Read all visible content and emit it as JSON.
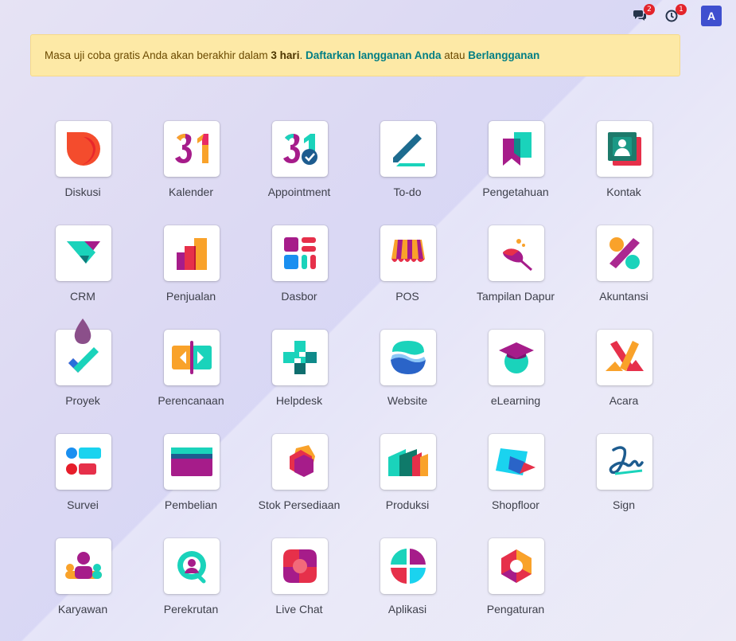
{
  "topbar": {
    "messages_badge": "2",
    "activities_badge": "1",
    "avatar_letter": "A"
  },
  "banner": {
    "text_before": "Masa uji coba gratis Anda akan berakhir dalam ",
    "days": "3 hari",
    "after_days": ". ",
    "register_link": "Daftarkan langganan Anda",
    "or": " atau ",
    "subscribe_link": "Berlangganan"
  },
  "apps": [
    {
      "label": "Diskusi",
      "icon": "discuss-icon"
    },
    {
      "label": "Kalender",
      "icon": "calendar-icon"
    },
    {
      "label": "Appointment",
      "icon": "appointment-icon"
    },
    {
      "label": "To-do",
      "icon": "todo-icon"
    },
    {
      "label": "Pengetahuan",
      "icon": "knowledge-icon"
    },
    {
      "label": "Kontak",
      "icon": "contacts-icon"
    },
    {
      "label": "CRM",
      "icon": "crm-icon"
    },
    {
      "label": "Penjualan",
      "icon": "sales-icon"
    },
    {
      "label": "Dasbor",
      "icon": "dashboard-icon"
    },
    {
      "label": "POS",
      "icon": "pos-icon"
    },
    {
      "label": "Tampilan Dapur",
      "icon": "kitchen-display-icon"
    },
    {
      "label": "Akuntansi",
      "icon": "accounting-icon"
    },
    {
      "label": "Proyek",
      "icon": "project-icon"
    },
    {
      "label": "Perencanaan",
      "icon": "planning-icon"
    },
    {
      "label": "Helpdesk",
      "icon": "helpdesk-icon"
    },
    {
      "label": "Website",
      "icon": "website-icon"
    },
    {
      "label": "eLearning",
      "icon": "elearning-icon"
    },
    {
      "label": "Acara",
      "icon": "events-icon"
    },
    {
      "label": "Survei",
      "icon": "survey-icon"
    },
    {
      "label": "Pembelian",
      "icon": "purchase-icon"
    },
    {
      "label": "Stok Persediaan",
      "icon": "inventory-icon"
    },
    {
      "label": "Produksi",
      "icon": "manufacturing-icon"
    },
    {
      "label": "Shopfloor",
      "icon": "shopfloor-icon"
    },
    {
      "label": "Sign",
      "icon": "sign-icon"
    },
    {
      "label": "Karyawan",
      "icon": "employees-icon"
    },
    {
      "label": "Perekrutan",
      "icon": "recruitment-icon"
    },
    {
      "label": "Live Chat",
      "icon": "live-chat-icon"
    },
    {
      "label": "Aplikasi",
      "icon": "apps-icon"
    },
    {
      "label": "Pengaturan",
      "icon": "settings-icon"
    }
  ],
  "colors": {
    "banner_bg": "#fde9a6",
    "link": "#017e84",
    "badge": "#e3242b",
    "avatar": "#3f4fcf"
  }
}
